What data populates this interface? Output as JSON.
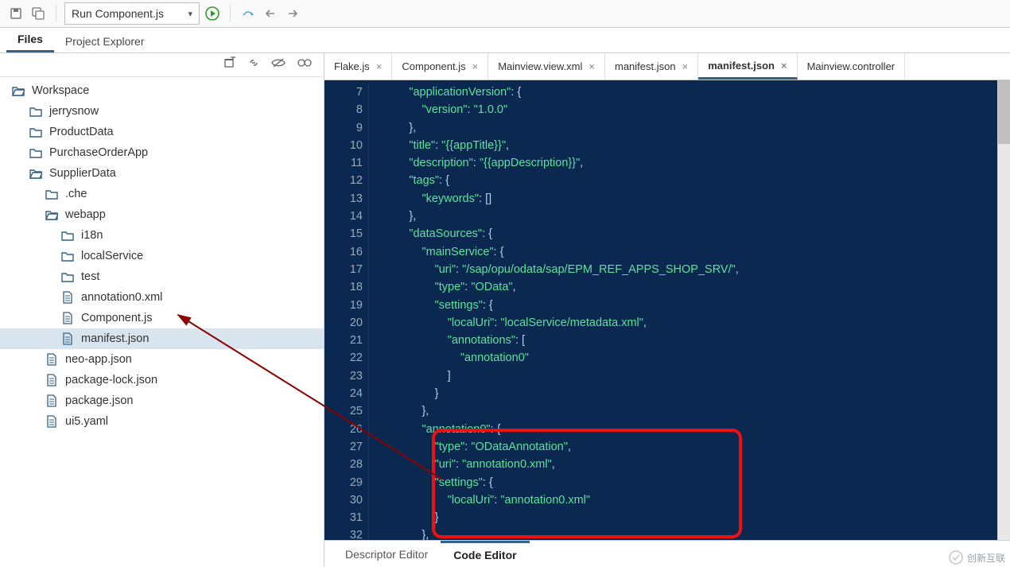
{
  "toolbar": {
    "run_select": "Run Component.js"
  },
  "ws_tabs": {
    "files": "Files",
    "project_explorer": "Project Explorer"
  },
  "tree": {
    "root": "Workspace",
    "items": [
      {
        "label": "jerrysnow",
        "depth": 1,
        "type": "folder",
        "open": false
      },
      {
        "label": "ProductData",
        "depth": 1,
        "type": "folder",
        "open": false
      },
      {
        "label": "PurchaseOrderApp",
        "depth": 1,
        "type": "folder",
        "open": false
      },
      {
        "label": "SupplierData",
        "depth": 1,
        "type": "folder-open",
        "open": true
      },
      {
        "label": ".che",
        "depth": 2,
        "type": "folder",
        "open": false
      },
      {
        "label": "webapp",
        "depth": 2,
        "type": "folder-open",
        "open": true
      },
      {
        "label": "i18n",
        "depth": 3,
        "type": "folder",
        "open": false
      },
      {
        "label": "localService",
        "depth": 3,
        "type": "folder",
        "open": false
      },
      {
        "label": "test",
        "depth": 3,
        "type": "folder",
        "open": false
      },
      {
        "label": "annotation0.xml",
        "depth": 3,
        "type": "file",
        "open": false
      },
      {
        "label": "Component.js",
        "depth": 3,
        "type": "file",
        "open": false
      },
      {
        "label": "manifest.json",
        "depth": 3,
        "type": "file",
        "open": false,
        "selected": true
      },
      {
        "label": "neo-app.json",
        "depth": 2,
        "type": "file",
        "open": false
      },
      {
        "label": "package-lock.json",
        "depth": 2,
        "type": "file",
        "open": false
      },
      {
        "label": "package.json",
        "depth": 2,
        "type": "file",
        "open": false
      },
      {
        "label": "ui5.yaml",
        "depth": 2,
        "type": "file",
        "open": false
      }
    ]
  },
  "editor_tabs": [
    {
      "label": "Flake.js",
      "active": false
    },
    {
      "label": "Component.js",
      "active": false
    },
    {
      "label": "Mainview.view.xml",
      "active": false
    },
    {
      "label": "manifest.json",
      "active": false
    },
    {
      "label": "manifest.json",
      "active": true
    },
    {
      "label": "Mainview.controller",
      "active": false,
      "noclose": true
    }
  ],
  "code": {
    "first_line_number": 7,
    "lines": [
      "            \"applicationVersion\": {",
      "                \"version\": \"1.0.0\"",
      "            },",
      "            \"title\": \"{{appTitle}}\",",
      "            \"description\": \"{{appDescription}}\",",
      "            \"tags\": {",
      "                \"keywords\": []",
      "            },",
      "            \"dataSources\": {",
      "                \"mainService\": {",
      "                    \"uri\": \"/sap/opu/odata/sap/EPM_REF_APPS_SHOP_SRV/\",",
      "                    \"type\": \"OData\",",
      "                    \"settings\": {",
      "                        \"localUri\": \"localService/metadata.xml\",",
      "                        \"annotations\": [",
      "                            \"annotation0\"",
      "                        ]",
      "                    }",
      "                },",
      "                \"annotation0\": {",
      "                    \"type\": \"ODataAnnotation\",",
      "                    \"uri\": \"annotation0.xml\",",
      "                    \"settings\": {",
      "                        \"localUri\": \"annotation0.xml\"",
      "                    }",
      "                },",
      "            }"
    ]
  },
  "editor_bottom": {
    "descriptor": "Descriptor Editor",
    "code": "Code Editor"
  },
  "watermark": "创新互联"
}
